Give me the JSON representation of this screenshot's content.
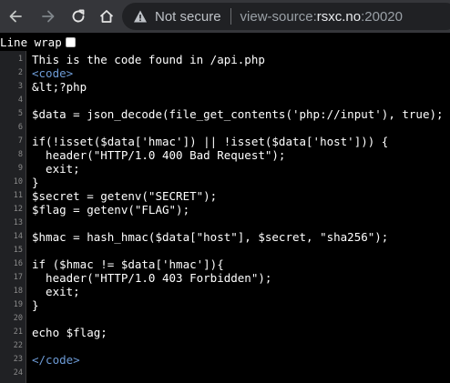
{
  "browser": {
    "security_label": "Not secure",
    "url_scheme": "view-source:",
    "url_host": "rsxc.no",
    "url_port": ":20020"
  },
  "wrapbar": {
    "label": "Line wrap",
    "checked": false
  },
  "source_lines": [
    {
      "num": "1",
      "text": "This is the code found in /api.php",
      "kind": "text"
    },
    {
      "num": "2",
      "text": "<code>",
      "kind": "tag"
    },
    {
      "num": "3",
      "text": "&lt;?php",
      "kind": "text"
    },
    {
      "num": "4",
      "text": "",
      "kind": "text"
    },
    {
      "num": "5",
      "text": "$data = json_decode(file_get_contents('php://input'), true);",
      "kind": "text"
    },
    {
      "num": "6",
      "text": "",
      "kind": "text"
    },
    {
      "num": "7",
      "text": "if(!isset($data['hmac']) || !isset($data['host'])) {",
      "kind": "text"
    },
    {
      "num": "8",
      "text": "  header(\"HTTP/1.0 400 Bad Request\");",
      "kind": "text"
    },
    {
      "num": "9",
      "text": "  exit;",
      "kind": "text"
    },
    {
      "num": "10",
      "text": "}",
      "kind": "text"
    },
    {
      "num": "11",
      "text": "$secret = getenv(\"SECRET\");",
      "kind": "text"
    },
    {
      "num": "12",
      "text": "$flag = getenv(\"FLAG\");",
      "kind": "text"
    },
    {
      "num": "13",
      "text": "",
      "kind": "text"
    },
    {
      "num": "14",
      "text": "$hmac = hash_hmac($data[\"host\"], $secret, \"sha256\");",
      "kind": "text"
    },
    {
      "num": "15",
      "text": "",
      "kind": "text"
    },
    {
      "num": "16",
      "text": "if ($hmac != $data['hmac']){",
      "kind": "text"
    },
    {
      "num": "17",
      "text": "  header(\"HTTP/1.0 403 Forbidden\");",
      "kind": "text"
    },
    {
      "num": "18",
      "text": "  exit;",
      "kind": "text"
    },
    {
      "num": "19",
      "text": "}",
      "kind": "text"
    },
    {
      "num": "20",
      "text": "",
      "kind": "text"
    },
    {
      "num": "21",
      "text": "echo $flag;",
      "kind": "text"
    },
    {
      "num": "22",
      "text": "",
      "kind": "text"
    },
    {
      "num": "23",
      "text": "</code>",
      "kind": "tag"
    },
    {
      "num": "24",
      "text": "",
      "kind": "text"
    }
  ],
  "colors": {
    "tag": "#6d9bd6",
    "toolbar": "#35363a",
    "omnibox": "#202124"
  },
  "icons": [
    "back-arrow-icon",
    "forward-arrow-icon",
    "reload-icon",
    "home-icon",
    "warning-triangle-icon"
  ]
}
